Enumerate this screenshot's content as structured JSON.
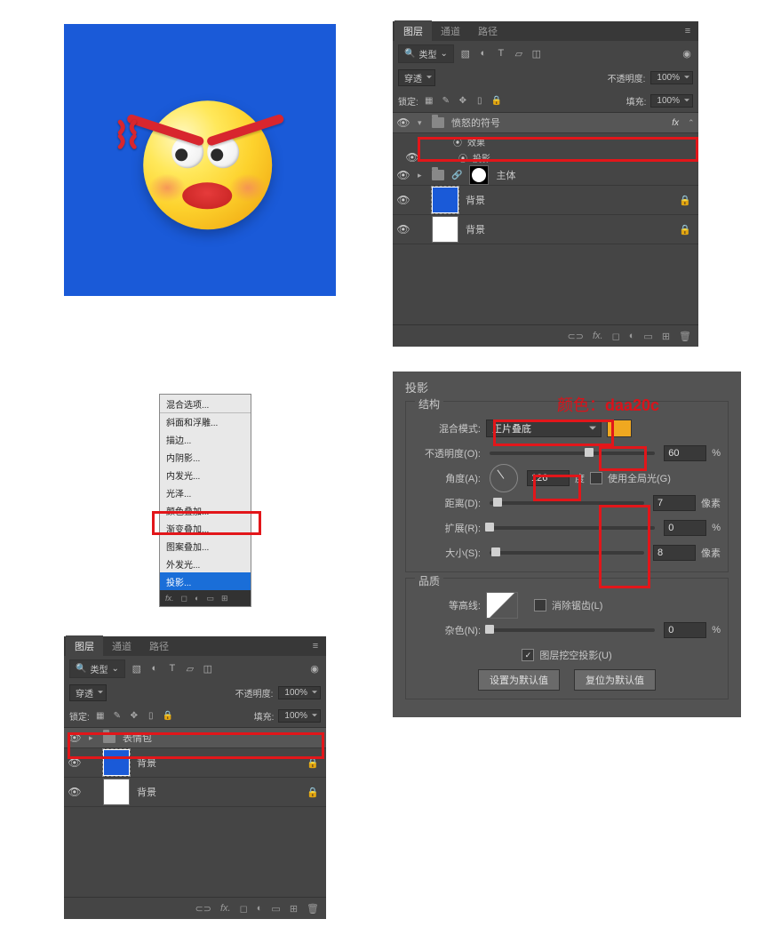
{
  "panel1": {
    "tabs": [
      "图层",
      "通道",
      "路径"
    ],
    "filter_label": "类型",
    "blend_mode": "穿透",
    "opacity_label": "不透明度:",
    "opacity_value": "100%",
    "lock_label": "锁定:",
    "fill_label": "填充:",
    "fill_value": "100%",
    "layers": [
      {
        "name": "愤怒的符号",
        "type": "group",
        "fx": "fx"
      },
      {
        "effects_header": "效果"
      },
      {
        "effect_name": "投影"
      },
      {
        "name": "主体",
        "type": "group_masked"
      },
      {
        "name": "背景",
        "type": "blue",
        "locked": true
      },
      {
        "name": "背景",
        "type": "white",
        "locked": true
      }
    ]
  },
  "ctx_menu": {
    "items": [
      "混合选项...",
      "斜面和浮雕...",
      "描边...",
      "内阴影...",
      "内发光...",
      "光泽...",
      "颜色叠加...",
      "渐变叠加...",
      "图案叠加...",
      "外发光...",
      "投影..."
    ],
    "selected_index": 10
  },
  "panel2": {
    "tabs": [
      "图层",
      "通道",
      "路径"
    ],
    "filter_label": "类型",
    "blend_mode": "穿透",
    "opacity_label": "不透明度:",
    "opacity_value": "100%",
    "lock_label": "锁定:",
    "fill_label": "填充:",
    "fill_value": "100%",
    "layers": [
      {
        "name": "表情包",
        "type": "group"
      },
      {
        "name": "背景",
        "type": "blue",
        "locked": true
      },
      {
        "name": "背景",
        "type": "white",
        "locked": true
      }
    ]
  },
  "dialog": {
    "title": "投影",
    "struct_label": "结构",
    "blend_mode_label": "混合模式:",
    "blend_mode_value": "正片叠底",
    "opacity_label": "不透明度(O):",
    "opacity_value": "60",
    "angle_label": "角度(A):",
    "angle_value": "126",
    "angle_unit": "度",
    "global_light_label": "使用全局光(G)",
    "distance_label": "距离(D):",
    "distance_value": "7",
    "px_unit": "像素",
    "spread_label": "扩展(R):",
    "spread_value": "0",
    "pct_unit": "%",
    "size_label": "大小(S):",
    "size_value": "8",
    "quality_label": "品质",
    "contour_label": "等高线:",
    "antialias_label": "消除锯齿(L)",
    "noise_label": "杂色(N):",
    "noise_value": "0",
    "knockout_label": "图层挖空投影(U)",
    "btn_default": "设置为默认值",
    "btn_reset": "复位为默认值",
    "color_annotation": "颜色：daa20c"
  }
}
